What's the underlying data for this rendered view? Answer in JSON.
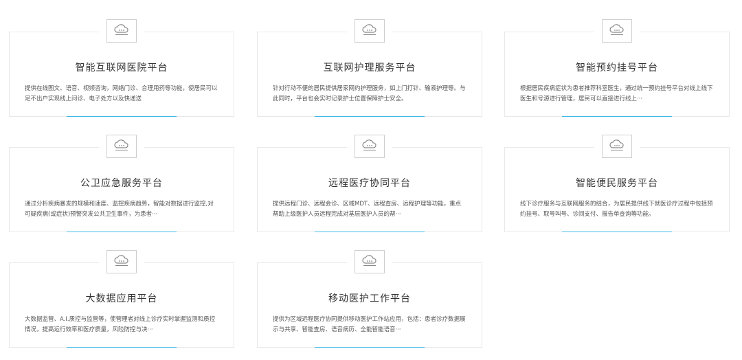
{
  "cards": [
    {
      "title": "智能互联网医院平台",
      "desc": "提供在线图文、语音、视频咨询，网络门诊、合理用药等功能，使居民可以足不出户实现线上问诊、电子处方以及快递送"
    },
    {
      "title": "互联网护理服务平台",
      "desc": "针对行动不便的居民提供居家网约护理服务，如上门打针、输液护理等。与此同时，平台也会实时记录护士位置保障护士安全。"
    },
    {
      "title": "智能预约挂号平台",
      "desc": "根据居民疾病症状为患者推荐科室医生，通过统一预约挂号平台对线上线下医生和号源进行管理，居民可以直接进行线上···"
    },
    {
      "title": "公卫应急服务平台",
      "desc": "通过分析疾病暴发的规模和速度、监控疾病趋势，智能对数据进行监控,对可疑疾病(或症状)预警突发公共卫生事件，为患者···"
    },
    {
      "title": "远程医疗协同平台",
      "desc": "提供远程门诊、远程会诊、区域MDT、远程查房、远程护理等功能，重点帮助上级医护人员远程完成对基层医护人员的帮···"
    },
    {
      "title": "智能便民服务平台",
      "desc": "线下诊疗服务与互联网服务的结合，为居民提供线下就医诊疗过程中包括预约挂号、取号叫号、诊间支付、报告单查询等功能。"
    },
    {
      "title": "大数据应用平台",
      "desc": "大数据监管、A.I.质控与监管等，使管理者对线上诊疗实时掌握监测和质控情况，提高运行效率和医疗质量，风险防控与决···"
    },
    {
      "title": "移动医护工作平台",
      "desc": "提供为区域远程医疗协同提供移动医护工作站应用，包括：患者诊疗数据展示与共享、智能查房、语音病历、全能智能语音···"
    }
  ],
  "icon": "cloud-icon",
  "colors": {
    "accent": "#3fb8e8",
    "border": "#e8e8e8",
    "title": "#333333",
    "text": "#555555"
  }
}
